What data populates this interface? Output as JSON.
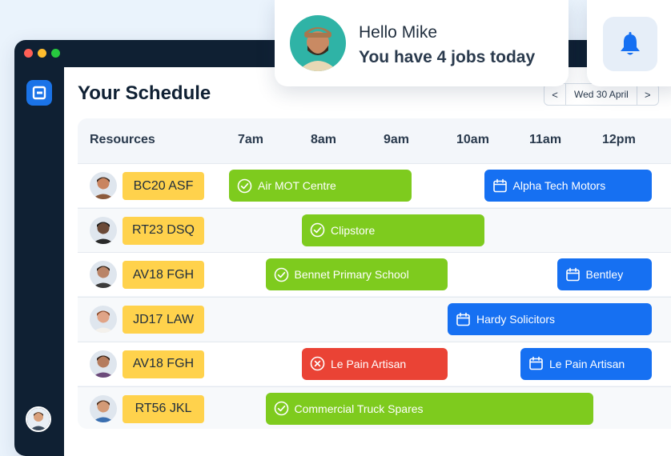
{
  "notification": {
    "greeting": "Hello Mike",
    "message": "You have 4 jobs today"
  },
  "page": {
    "title": "Your Schedule",
    "date_label": "Wed 30 April",
    "prev_label": "<",
    "next_label": ">"
  },
  "schedule": {
    "resources_header": "Resources",
    "hours": [
      "7am",
      "8am",
      "9am",
      "10am",
      "11am",
      "12pm"
    ],
    "rows": [
      {
        "plate": "BC20 ASF",
        "skin": "#c9845f",
        "shirt": "#8b5a3c",
        "hair": "#3a2b22",
        "jobs": [
          {
            "label": "Air MOT Centre",
            "status": "completed",
            "start": 7.0,
            "end": 9.5
          },
          {
            "label": "Alpha Tech Motors",
            "status": "scheduled",
            "start": 10.5,
            "end": 12.8
          }
        ]
      },
      {
        "plate": "RT23 DSQ",
        "skin": "#6b4a38",
        "shirt": "#2a2a2a",
        "hair": "#1a1a1a",
        "jobs": [
          {
            "label": "Clipstore",
            "status": "completed",
            "start": 8.0,
            "end": 10.5
          }
        ]
      },
      {
        "plate": "AV18 FGH",
        "skin": "#b98468",
        "shirt": "#3b3b3b",
        "hair": "#2c2119",
        "jobs": [
          {
            "label": "Bennet Primary School",
            "status": "completed",
            "start": 7.5,
            "end": 10.0
          },
          {
            "label": "Bentley",
            "status": "scheduled",
            "start": 11.5,
            "end": 12.8
          }
        ]
      },
      {
        "plate": "JD17 LAW",
        "skin": "#e0a487",
        "shirt": "#f4f1ec",
        "hair": "#8a4a2a",
        "jobs": [
          {
            "label": "Hardy Solicitors",
            "status": "scheduled",
            "start": 10.0,
            "end": 12.8
          }
        ]
      },
      {
        "plate": "AV18 FGH",
        "skin": "#b57c5e",
        "shirt": "#6b4a7a",
        "hair": "#2f2018",
        "jobs": [
          {
            "label": "Le Pain Artisan",
            "status": "cancelled",
            "start": 8.0,
            "end": 10.0
          },
          {
            "label": "Le Pain Artisan",
            "status": "scheduled",
            "start": 11.0,
            "end": 12.8
          }
        ]
      },
      {
        "plate": "RT56 JKL",
        "skin": "#d39a76",
        "shirt": "#3a6fb0",
        "hair": "#4a2e1d",
        "jobs": [
          {
            "label": "Commercial Truck Spares",
            "status": "completed",
            "start": 7.5,
            "end": 12.0
          }
        ]
      }
    ]
  },
  "colors": {
    "completed": "#7ecb1e",
    "scheduled": "#1670f2",
    "cancelled": "#ea4335",
    "plate": "#ffd24c",
    "sidebar": "#0f2033",
    "accent": "#1a73e8"
  },
  "icons": {
    "completed": "check-circle-icon",
    "scheduled": "calendar-icon",
    "cancelled": "x-circle-icon",
    "notification": "bell-icon",
    "logo": "app-logo-icon"
  }
}
